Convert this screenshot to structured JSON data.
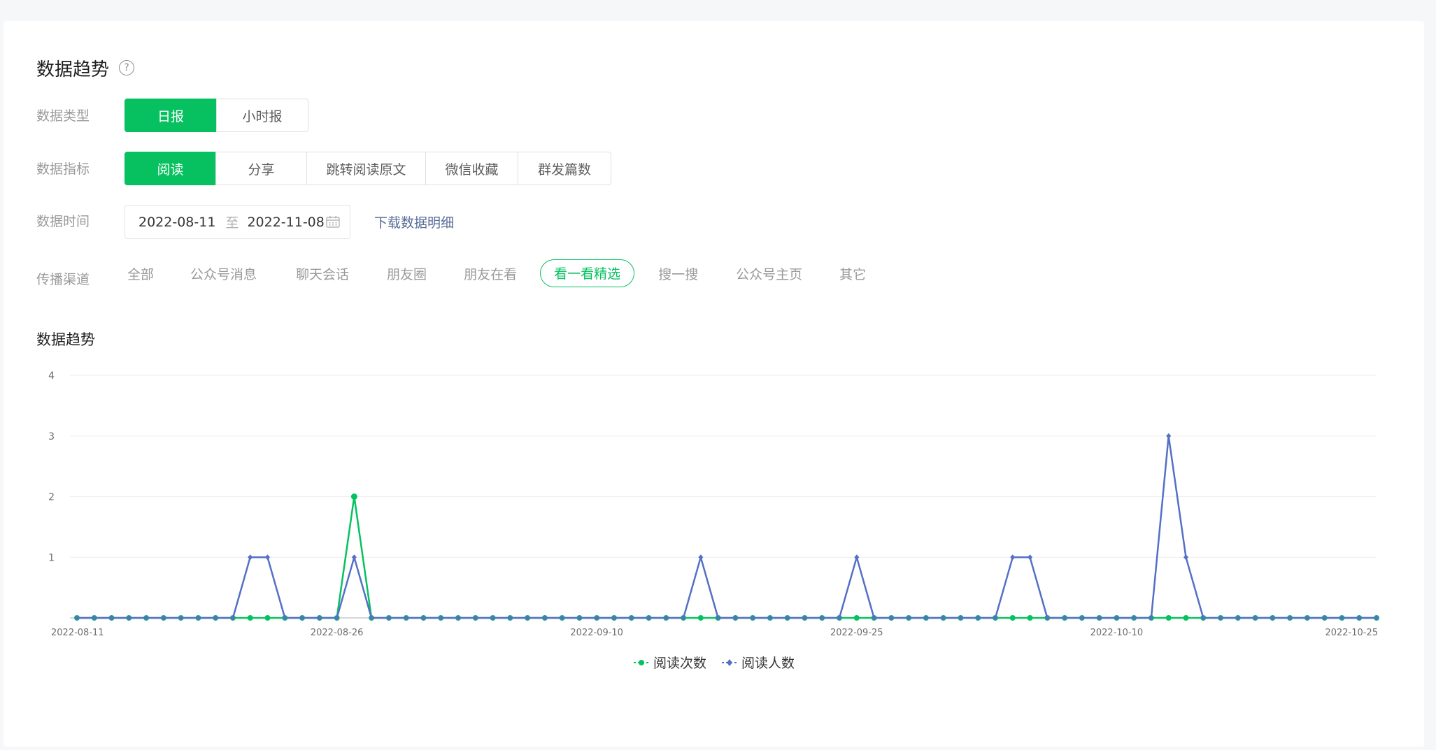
{
  "header": {
    "title": "数据趋势",
    "help_icon": "question-circle-icon"
  },
  "data_type": {
    "label": "数据类型",
    "options": [
      "日报",
      "小时报"
    ],
    "selected": "日报"
  },
  "metric": {
    "label": "数据指标",
    "options": [
      "阅读",
      "分享",
      "跳转阅读原文",
      "微信收藏",
      "群发篇数"
    ],
    "selected": "阅读"
  },
  "time": {
    "label": "数据时间",
    "start": "2022-08-11",
    "separator": "至",
    "end": "2022-11-08",
    "icon": "calendar-icon",
    "download_label": "下载数据明细"
  },
  "channel": {
    "label": "传播渠道",
    "options": [
      "全部",
      "公众号消息",
      "聊天会话",
      "朋友圈",
      "朋友在看",
      "看一看精选",
      "搜一搜",
      "公众号主页",
      "其它"
    ],
    "selected": "看一看精选"
  },
  "colors": {
    "accent": "#07c160",
    "link": "#576b95",
    "series2": "#5470c6"
  },
  "chart_data": {
    "type": "line",
    "title": "数据趋势",
    "x_start": "2022-08-11",
    "x_end": "2022-10-25",
    "x_tick_labels": [
      "2022-08-11",
      "2022-08-26",
      "2022-09-10",
      "2022-09-25",
      "2022-10-10",
      "2022-10-25"
    ],
    "ylim": [
      0,
      4
    ],
    "y_ticks": [
      1,
      2,
      3,
      4
    ],
    "grid": true,
    "legend_position": "bottom-center",
    "series": [
      {
        "name": "阅读次数",
        "color": "#07c160",
        "marker": "circle",
        "points": [
          {
            "x": "2022-08-27",
            "y": 2
          }
        ]
      },
      {
        "name": "阅读人数",
        "color": "#5470c6",
        "marker": "diamond",
        "points": [
          {
            "x": "2022-08-21",
            "y": 1
          },
          {
            "x": "2022-08-22",
            "y": 1
          },
          {
            "x": "2022-08-27",
            "y": 1
          },
          {
            "x": "2022-09-16",
            "y": 1
          },
          {
            "x": "2022-09-25",
            "y": 1
          },
          {
            "x": "2022-10-04",
            "y": 1
          },
          {
            "x": "2022-10-05",
            "y": 1
          },
          {
            "x": "2022-10-13",
            "y": 3
          },
          {
            "x": "2022-10-14",
            "y": 1
          }
        ]
      }
    ]
  }
}
